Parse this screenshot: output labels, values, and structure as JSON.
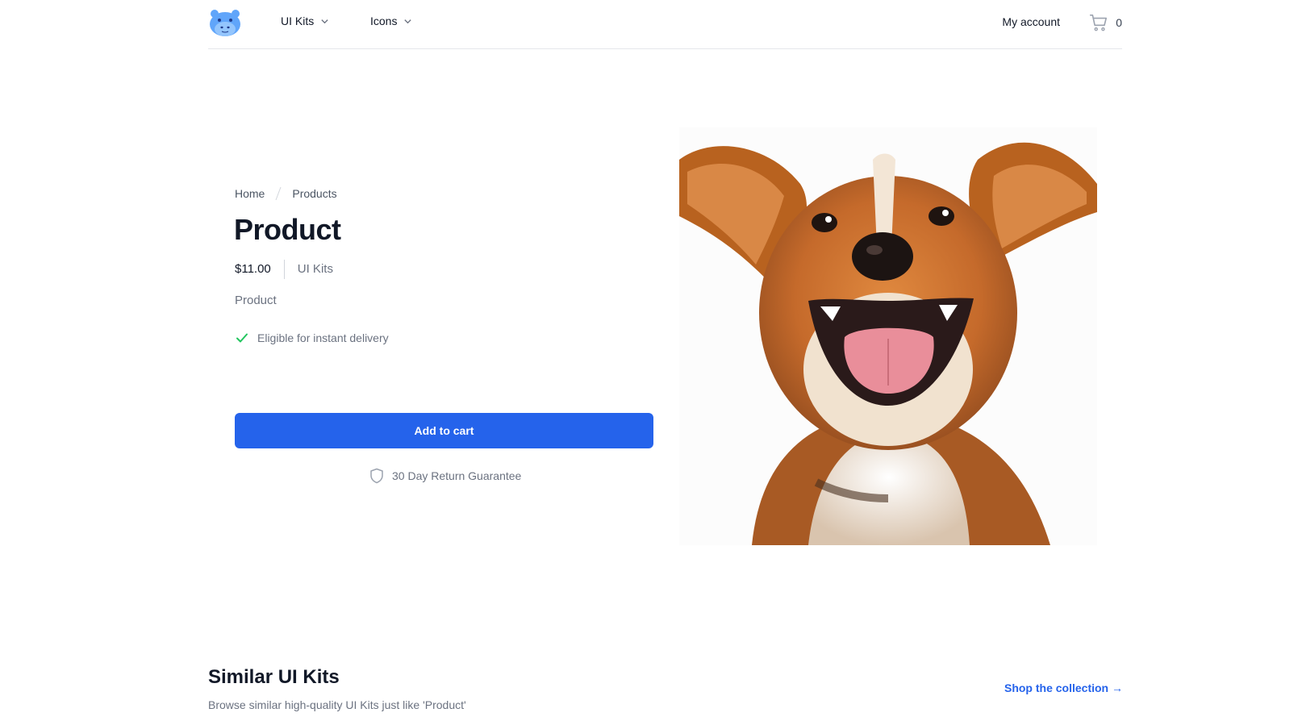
{
  "header": {
    "logo_alt": "hippo-logo",
    "nav": [
      {
        "label": "UI Kits"
      },
      {
        "label": "Icons"
      }
    ],
    "account_label": "My account",
    "cart_count": "0"
  },
  "product": {
    "breadcrumb": [
      {
        "label": "Home"
      },
      {
        "label": "Products"
      }
    ],
    "title": "Product",
    "price": "$11.00",
    "category": "UI Kits",
    "description": "Product",
    "delivery_text": "Eligible for instant delivery",
    "add_to_cart_label": "Add to cart",
    "guarantee_text": "30 Day Return Guarantee",
    "image_subject": "happy-dog"
  },
  "similar": {
    "title": "Similar UI Kits",
    "subtitle": "Browse similar high-quality UI Kits just like 'Product'",
    "shop_link": "Shop the collection →"
  },
  "colors": {
    "accent": "#2563eb",
    "check": "#22c55e",
    "logo": "#60a5fa",
    "text_primary": "#111827",
    "text_muted": "#6b7280"
  }
}
